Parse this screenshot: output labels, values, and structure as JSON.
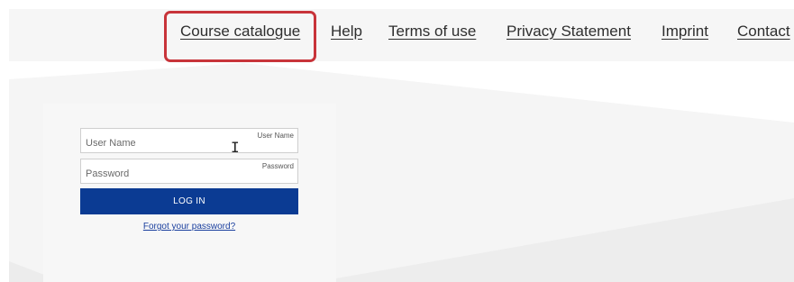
{
  "nav": {
    "items": [
      {
        "label": "Course catalogue"
      },
      {
        "label": "Help"
      },
      {
        "label": "Terms of use"
      },
      {
        "label": "Privacy Statement"
      },
      {
        "label": "Imprint"
      },
      {
        "label": "Contact"
      }
    ]
  },
  "login": {
    "username": {
      "placeholder": "User Name",
      "floating_label": "User Name",
      "value": ""
    },
    "password": {
      "placeholder": "Password",
      "floating_label": "Password",
      "value": ""
    },
    "button_label": "LOG IN",
    "forgot_link": "Forgot your password?"
  },
  "colors": {
    "highlight": "#c8343a",
    "button": "#0b3b93",
    "link": "#1a3f9e"
  },
  "icons": {
    "cursor": "text-cursor-icon"
  }
}
